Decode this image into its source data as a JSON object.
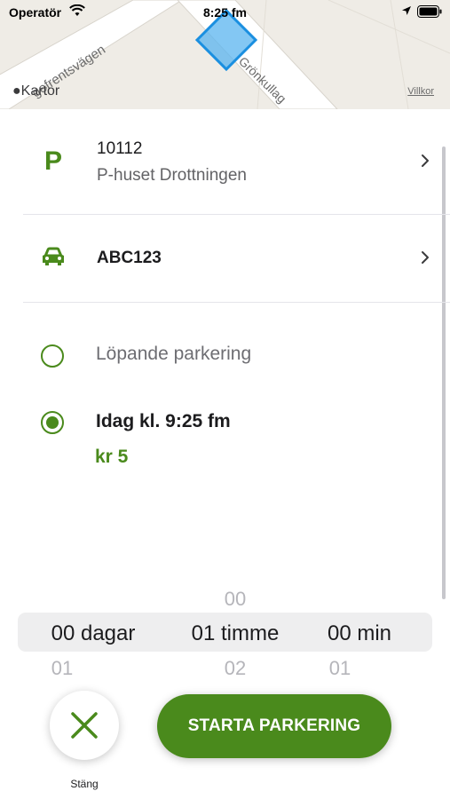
{
  "status_bar": {
    "carrier": "Operatör",
    "time": "8:25 fm"
  },
  "map": {
    "street_1": "gefrentsvägen",
    "street_2": "Grönkullag",
    "attribution": "Kartor",
    "terms_link": "Villkor"
  },
  "parking_lot": {
    "id": "10112",
    "name": "P-huset Drottningen",
    "icon": "parking-icon"
  },
  "vehicle": {
    "plate": "ABC123",
    "icon": "car-icon"
  },
  "options": [
    {
      "label": "Löpande parkering",
      "selected": false
    },
    {
      "label": "Idag kl. 9:25 fm",
      "selected": true,
      "price": "kr 5"
    }
  ],
  "duration_picker": {
    "days": {
      "selected": "00 dagar",
      "below": "01"
    },
    "hours": {
      "above": "00",
      "selected": "01 timme",
      "below": "02"
    },
    "minutes": {
      "selected": "00 min",
      "below": "01"
    }
  },
  "actions": {
    "close_label": "Stäng",
    "start_label": "STARTA PARKERING"
  },
  "colors": {
    "accent": "#4a8a1c",
    "map_background": "#efece6",
    "zone_highlight": "#4aa8e8"
  }
}
